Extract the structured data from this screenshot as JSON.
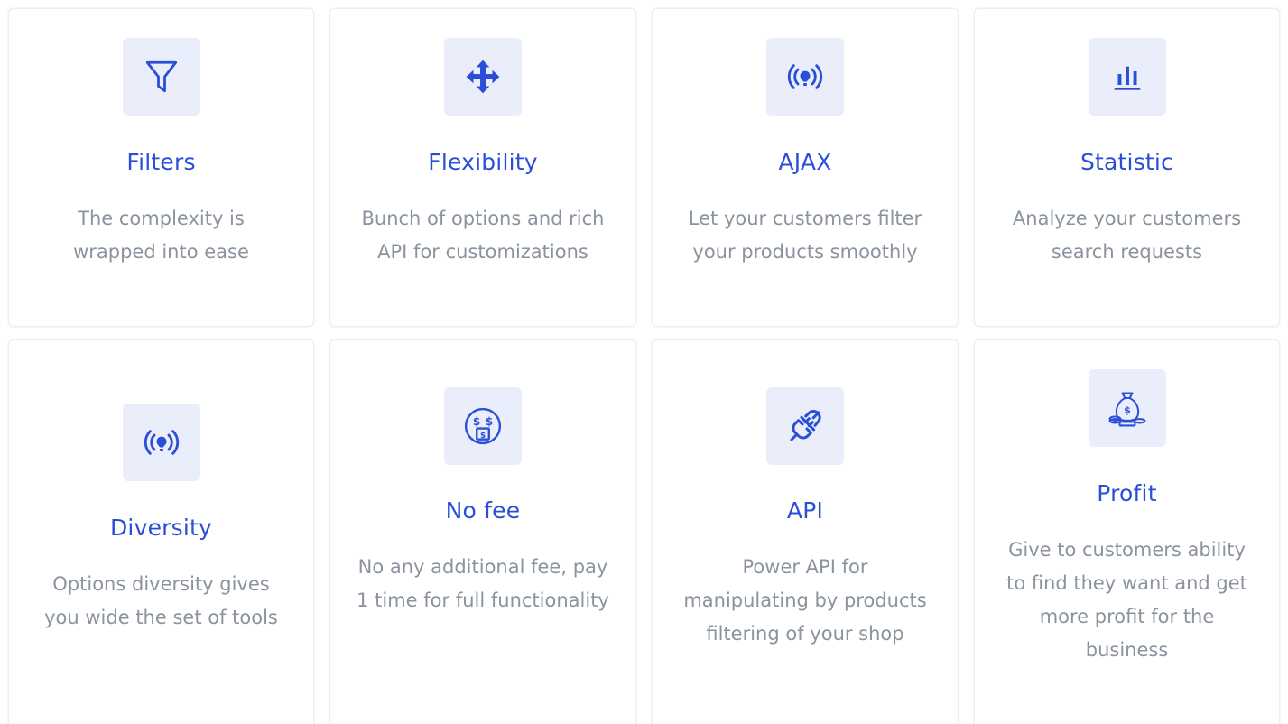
{
  "accent_color": "#2a4fd6",
  "icon_background": "#e9eefa",
  "text_muted_color": "#8a939e",
  "features": [
    {
      "icon": "filter-icon",
      "title": "Filters",
      "description": "The complexity is wrapped into ease"
    },
    {
      "icon": "move-arrows-icon",
      "title": "Flexibility",
      "description": "Bunch of options and rich API for customizations"
    },
    {
      "icon": "broadcast-icon",
      "title": "AJAX",
      "description": "Let your customers filter your products smoothly"
    },
    {
      "icon": "bar-chart-icon",
      "title": "Statistic",
      "description": "Analyze your customers search requests"
    },
    {
      "icon": "broadcast-icon",
      "title": "Diversity",
      "description": "Options diversity gives you wide the set of tools"
    },
    {
      "icon": "money-face-icon",
      "title": "No fee",
      "description": "No any additional fee, pay 1 time for full functionality"
    },
    {
      "icon": "plug-icon",
      "title": "API",
      "description": "Power API for manipulating by products filtering of your shop"
    },
    {
      "icon": "money-bag-icon",
      "title": "Profit",
      "description": "Give to customers ability to find they want and get more profit for the business"
    }
  ]
}
